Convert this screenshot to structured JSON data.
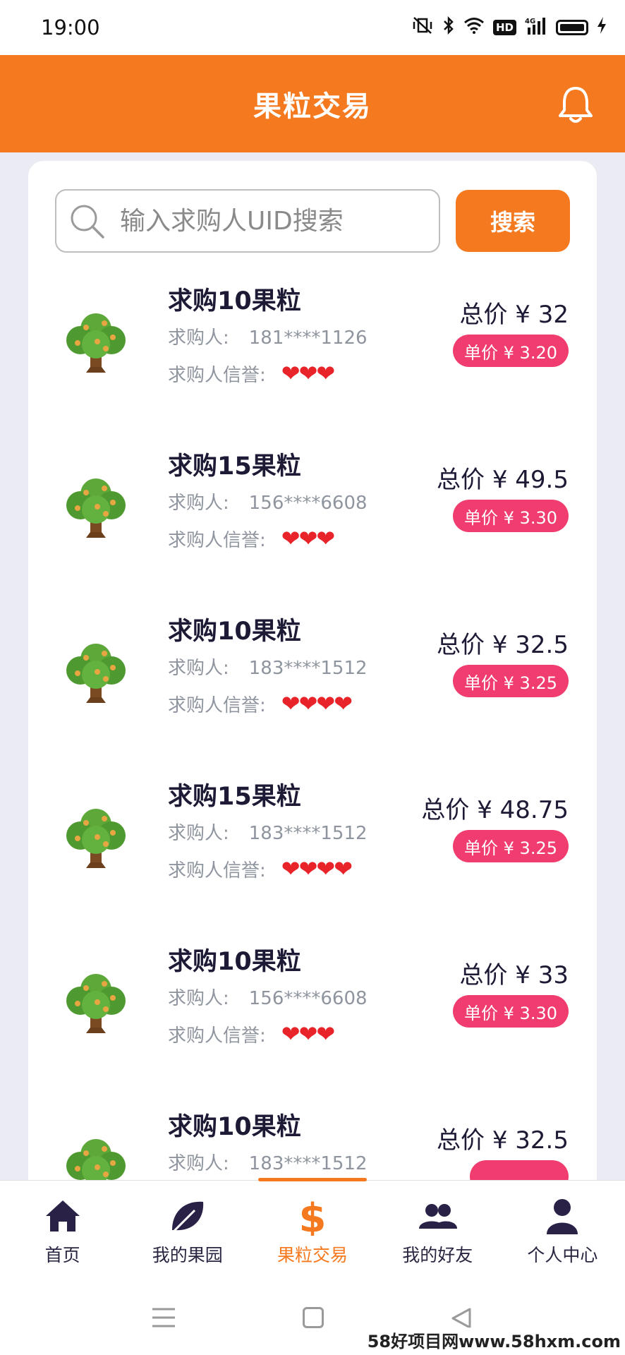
{
  "status_bar": {
    "time": "19:00",
    "icons": [
      "mute-vibrate-icon",
      "bluetooth-icon",
      "wifi-icon",
      "hd-icon",
      "signal-4g-icon",
      "battery-icon",
      "charging-icon"
    ],
    "hd_label": "HD",
    "network_label": "4G"
  },
  "header": {
    "title": "果粒交易",
    "bell_icon": "bell-icon",
    "color": "#f57a1f"
  },
  "search": {
    "placeholder": "输入求购人UID搜索",
    "button_label": "搜索"
  },
  "listings": [
    {
      "title": "求购10果粒",
      "buyer_label": "求购人:",
      "buyer": "181****1126",
      "credit_label": "求购人信誉:",
      "hearts": "❤❤❤",
      "total": "总价 ¥ 32",
      "unit": "单价 ¥ 3.20"
    },
    {
      "title": "求购15果粒",
      "buyer_label": "求购人:",
      "buyer": "156****6608",
      "credit_label": "求购人信誉:",
      "hearts": "❤❤❤",
      "total": "总价 ¥ 49.5",
      "unit": "单价 ¥ 3.30"
    },
    {
      "title": "求购10果粒",
      "buyer_label": "求购人:",
      "buyer": "183****1512",
      "credit_label": "求购人信誉:",
      "hearts": "❤❤❤❤",
      "total": "总价 ¥ 32.5",
      "unit": "单价 ¥ 3.25"
    },
    {
      "title": "求购15果粒",
      "buyer_label": "求购人:",
      "buyer": "183****1512",
      "credit_label": "求购人信誉:",
      "hearts": "❤❤❤❤",
      "total": "总价 ¥ 48.75",
      "unit": "单价 ¥ 3.25"
    },
    {
      "title": "求购10果粒",
      "buyer_label": "求购人:",
      "buyer": "156****6608",
      "credit_label": "求购人信誉:",
      "hearts": "❤❤❤",
      "total": "总价 ¥ 33",
      "unit": "单价 ¥ 3.30"
    },
    {
      "title": "求购10果粒",
      "buyer_label": "求购人:",
      "buyer": "183****1512",
      "credit_label": "",
      "hearts": "",
      "total": "总价 ¥ 32.5",
      "unit": ""
    }
  ],
  "tabs": [
    {
      "label": "首页",
      "icon": "home-icon"
    },
    {
      "label": "我的果园",
      "icon": "leaf-icon"
    },
    {
      "label": "果粒交易",
      "icon": "dollar-icon",
      "active": true
    },
    {
      "label": "我的好友",
      "icon": "friends-icon"
    },
    {
      "label": "个人中心",
      "icon": "person-icon"
    }
  ],
  "system_nav": [
    "menu-icon",
    "home-square-icon",
    "back-icon"
  ],
  "watermark": "58好项目网www.58hxm.com",
  "colors": {
    "accent": "#f57a1f",
    "badge": "#f03c6e",
    "heart": "#e8242a",
    "background": "#ebebf3"
  }
}
